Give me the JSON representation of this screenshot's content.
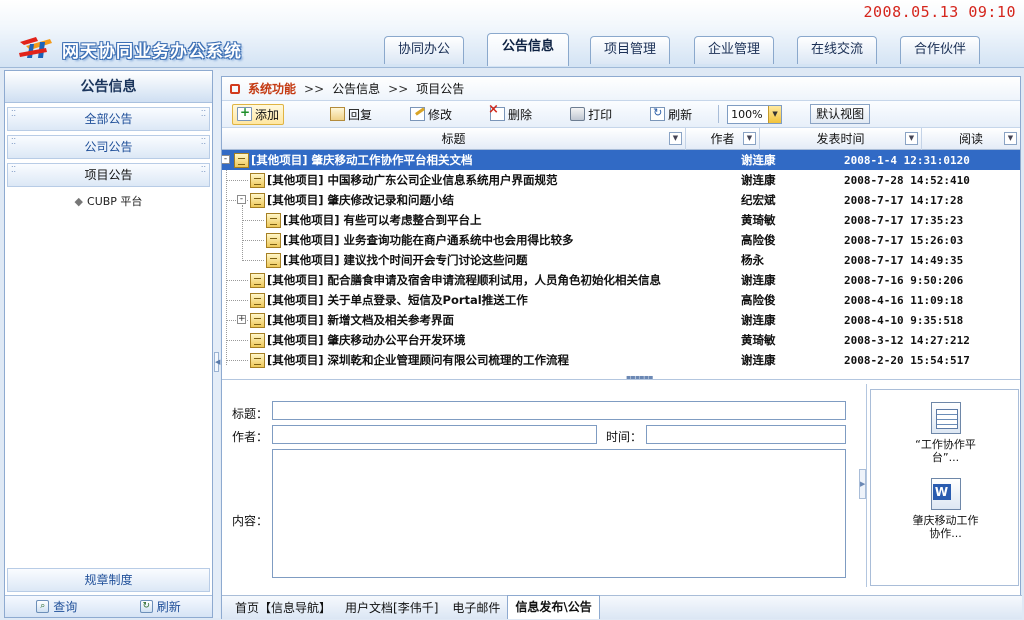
{
  "header": {
    "datetime": "2008.05.13   09:10",
    "app_title": "网天协同业务办公系统",
    "tabs": [
      {
        "label": "协同办公"
      },
      {
        "label": "公告信息"
      },
      {
        "label": "项目管理"
      },
      {
        "label": "企业管理"
      },
      {
        "label": "在线交流"
      },
      {
        "label": "合作伙伴"
      }
    ],
    "active_tab": "公告信息"
  },
  "sidebar": {
    "title": "公告信息",
    "items": [
      {
        "label": "全部公告"
      },
      {
        "label": "公司公告"
      },
      {
        "label": "项目公告"
      }
    ],
    "sub_item": "CUBP 平台",
    "rules_label": "规章制度",
    "footer": {
      "query": "查询",
      "refresh": "刷新"
    }
  },
  "breadcrumb": {
    "root": "系统功能",
    "sep": ">>",
    "level1": "公告信息",
    "level2": "项目公告"
  },
  "toolbar": {
    "add": "添加",
    "reply": "回复",
    "edit": "修改",
    "delete": "删除",
    "print": "打印",
    "refresh": "刷新",
    "zoom": "100%",
    "default_view": "默认视图"
  },
  "grid": {
    "columns": {
      "title": "标题",
      "author": "作者",
      "time": "发表时间",
      "read": "阅读"
    },
    "rows": [
      {
        "title": "[其他项目] 肇庆移动工作协作平台相关文档",
        "author": "谢连康",
        "time": "2008-1-4  12:31:0120",
        "toggle": "-",
        "level": 0,
        "selected": true
      },
      {
        "title": "[其他项目] 中国移动广东公司企业信息系统用户界面规范",
        "author": "谢连康",
        "time": "2008-7-28  14:52:410",
        "toggle": "",
        "level": 1,
        "selected": false
      },
      {
        "title": "[其他项目] 肇庆修改记录和问题小结",
        "author": "纪宏斌",
        "time": "2008-7-17  14:17:28",
        "toggle": "-",
        "level": 1,
        "selected": false
      },
      {
        "title": "[其他项目] 有些可以考虑整合到平台上",
        "author": "黄琦敏",
        "time": "2008-7-17  17:35:23",
        "toggle": "",
        "level": 2,
        "selected": false
      },
      {
        "title": "[其他项目] 业务查询功能在商户通系统中也会用得比较多",
        "author": "高险俊",
        "time": "2008-7-17  15:26:03",
        "toggle": "",
        "level": 2,
        "selected": false
      },
      {
        "title": "[其他项目] 建议找个时间开会专门讨论这些问题",
        "author": "杨永",
        "time": "2008-7-17  14:49:35",
        "toggle": "",
        "level": 2,
        "selected": false
      },
      {
        "title": "[其他项目] 配合膳食申请及宿舍申请流程顺利试用，人员角色初始化相关信息",
        "author": "谢连康",
        "time": "2008-7-16  9:50:206",
        "toggle": "",
        "level": 1,
        "selected": false
      },
      {
        "title": "[其他项目] 关于单点登录、短信及Portal推送工作",
        "author": "高险俊",
        "time": "2008-4-16  11:09:18",
        "toggle": "",
        "level": 1,
        "selected": false
      },
      {
        "title": "[其他项目] 新增文档及相关参考界面",
        "author": "谢连康",
        "time": "2008-4-10  9:35:518",
        "toggle": "+",
        "level": 1,
        "selected": false
      },
      {
        "title": "[其他项目] 肇庆移动办公平台开发环境",
        "author": "黄琦敏",
        "time": "2008-3-12  14:27:212",
        "toggle": "",
        "level": 1,
        "selected": false
      },
      {
        "title": "[其他项目] 深圳乾和企业管理顾问有限公司梳理的工作流程",
        "author": "谢连康",
        "time": "2008-2-20  15:54:517",
        "toggle": "",
        "level": 1,
        "selected": false
      }
    ]
  },
  "detail": {
    "title_label": "标题：",
    "author_label": "作者：",
    "time_label": "时间：",
    "content_label": "内容：",
    "title_value": "",
    "author_value": "",
    "time_value": "",
    "content_value": ""
  },
  "attachments": [
    {
      "name": "“工作协作平台”...",
      "icon": "excel-file-icon"
    },
    {
      "name": "肇庆移动工作协作...",
      "icon": "word-file-icon"
    }
  ],
  "bottom_tabs": [
    {
      "label": "首页【信息导航】"
    },
    {
      "label": "用户文档[李伟千]"
    },
    {
      "label": "电子邮件"
    },
    {
      "label": "信息发布\\公告"
    }
  ],
  "active_bottom_tab": "信息发布\\公告",
  "colors": {
    "selected_row": "#316ac5",
    "datetime": "#d5251c",
    "breadcrumb_root": "#c43a12"
  }
}
